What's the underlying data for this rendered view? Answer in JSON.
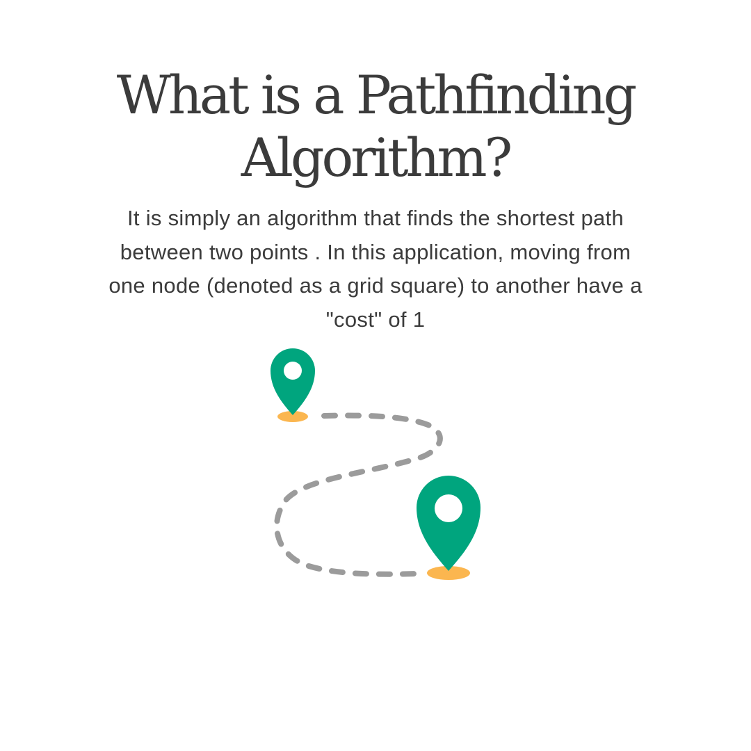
{
  "title": {
    "line1": "What is a Pathfinding",
    "line2": "Algorithm?"
  },
  "description": {
    "line1": "It is simply an algorithm that finds the shortest path",
    "line2": "between two points . In this application, moving from",
    "line3": "one node (denoted as a grid square) to another have a",
    "line4": "\"cost\" of 1"
  },
  "illustration": {
    "pin_icon": "map-pin-icon",
    "pin_color": "#00a57e",
    "shadow_color": "#fbb64f",
    "path_color": "#9b9b9b"
  }
}
